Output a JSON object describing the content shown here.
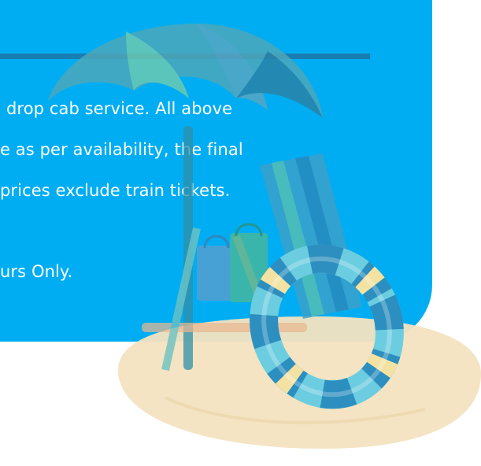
{
  "notice": {
    "lines": [
      "drop cab service. All above",
      "e as per availability, the final",
      "prices exclude train tickets.",
      "urs Only."
    ]
  },
  "colors": {
    "panel": "#00adf2",
    "rule": "#1c74a8",
    "sand": "#f3e3c0",
    "umbrella": "#4fa0b0",
    "lifebuoy_stripe": "#2c8fbf"
  },
  "illustration": {
    "icon_name": "beach-umbrella-chair-lifebuoy-icon"
  }
}
